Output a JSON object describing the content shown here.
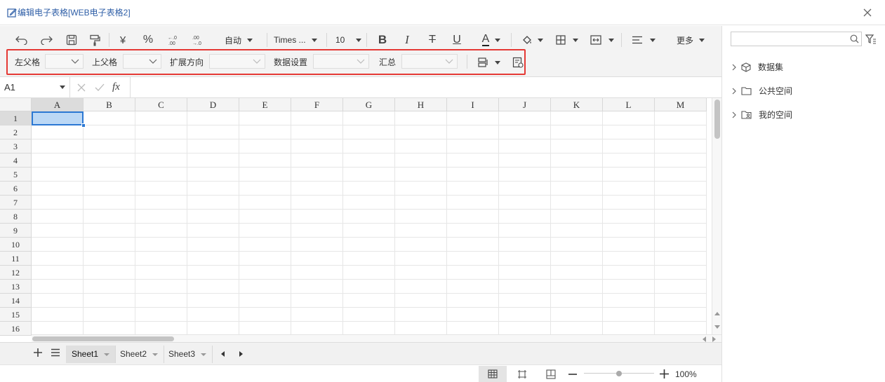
{
  "window": {
    "title": "编辑电子表格[WEB电子表格2]"
  },
  "toolbar": {
    "currency_symbol": "¥",
    "percent_symbol": "%",
    "auto_label": "自动",
    "font_family": "Times ...",
    "font_size": "10",
    "bold": "B",
    "italic": "I",
    "strike": "T",
    "underline": "U",
    "font_color_letter": "A",
    "more_label": "更多"
  },
  "bind_row": {
    "left_parent_label": "左父格",
    "top_parent_label": "上父格",
    "expand_direction_label": "扩展方向",
    "data_settings_label": "数据设置",
    "summary_label": "汇总"
  },
  "formula_bar": {
    "cell_ref": "A1",
    "fx": "fx"
  },
  "grid": {
    "columns": [
      "A",
      "B",
      "C",
      "D",
      "E",
      "F",
      "G",
      "H",
      "I",
      "J",
      "K",
      "L",
      "M"
    ],
    "rows": [
      "1",
      "2",
      "3",
      "4",
      "5",
      "6",
      "7",
      "8",
      "9",
      "10",
      "11",
      "12",
      "13",
      "14",
      "15",
      "16"
    ],
    "selected_cell": "A1"
  },
  "sheets": {
    "tabs": [
      "Sheet1",
      "Sheet2",
      "Sheet3"
    ],
    "active": "Sheet1"
  },
  "status": {
    "zoom": "100%",
    "zoom_level": 1.0
  },
  "sidebar": {
    "items": [
      {
        "label": "数据集",
        "icon": "cube-icon"
      },
      {
        "label": "公共空间",
        "icon": "folder-icon"
      },
      {
        "label": "我的空间",
        "icon": "user-folder-icon"
      }
    ]
  },
  "colors": {
    "highlight": "#e53935",
    "selection": "#2c78d3",
    "title": "#2f5fa7"
  }
}
